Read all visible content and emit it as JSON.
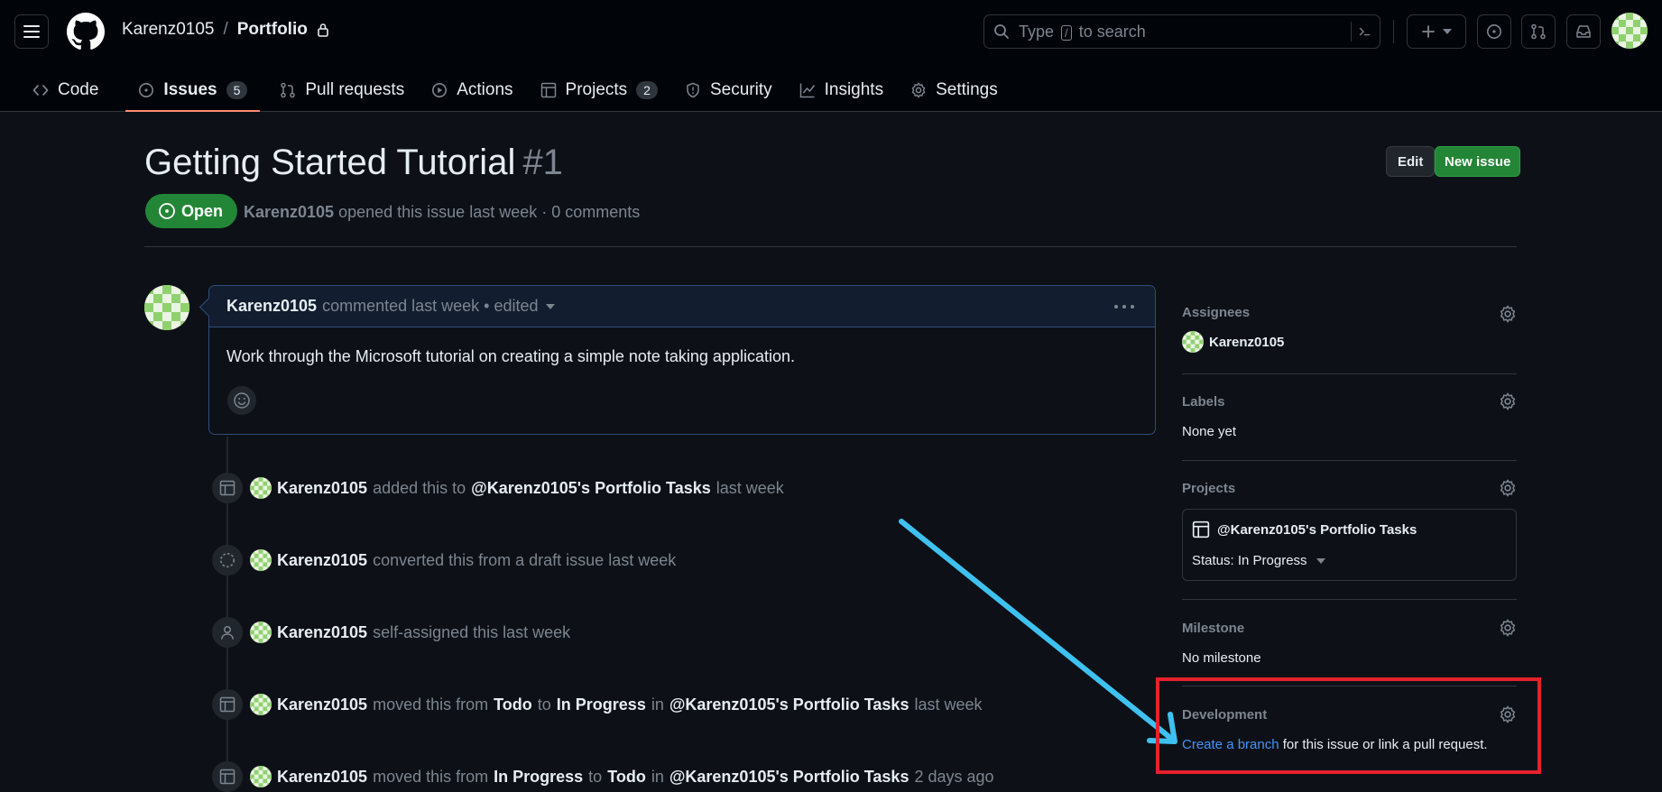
{
  "header": {
    "owner": "Karenz0105",
    "separator": "/",
    "repo": "Portfolio",
    "search_placeholder_pre": "Type",
    "search_key": "/",
    "search_placeholder_post": "to search"
  },
  "repo_nav": {
    "tabs": [
      {
        "label": "Code",
        "icon": "code-icon"
      },
      {
        "label": "Issues",
        "icon": "issue-opened-icon",
        "count": "5",
        "active": true
      },
      {
        "label": "Pull requests",
        "icon": "git-pull-request-icon"
      },
      {
        "label": "Actions",
        "icon": "play-icon"
      },
      {
        "label": "Projects",
        "icon": "table-icon",
        "count": "2"
      },
      {
        "label": "Security",
        "icon": "shield-icon"
      },
      {
        "label": "Insights",
        "icon": "graph-icon"
      },
      {
        "label": "Settings",
        "icon": "gear-icon"
      }
    ]
  },
  "issue": {
    "title": "Getting Started Tutorial",
    "number": "#1",
    "edit_label": "Edit",
    "new_issue_label": "New issue",
    "state": "Open",
    "author": "Karenz0105",
    "meta_text": "opened this issue last week · 0 comments"
  },
  "comment": {
    "author": "Karenz0105",
    "meta": "commented last week • edited",
    "body": "Work through the Microsoft tutorial on creating a simple note taking application."
  },
  "timeline": {
    "events": [
      {
        "actor": "Karenz0105",
        "t1": "added this to",
        "s1": "@Karenz0105's Portfolio Tasks",
        "t2": "last week"
      },
      {
        "actor": "Karenz0105",
        "t1": "converted this from a draft issue last week"
      },
      {
        "actor": "Karenz0105",
        "t1": "self-assigned this last week"
      },
      {
        "actor": "Karenz0105",
        "t1": "moved this from",
        "s1": "Todo",
        "t2": "to",
        "s2": "In Progress",
        "t3": "in",
        "s3": "@Karenz0105's Portfolio Tasks",
        "t4": "last week"
      },
      {
        "actor": "Karenz0105",
        "t1": "moved this from",
        "s1": "In Progress",
        "t2": "to",
        "s2": "Todo",
        "t3": "in",
        "s3": "@Karenz0105's Portfolio Tasks",
        "t4": "2 days ago"
      }
    ]
  },
  "sidebar": {
    "assignees": {
      "title": "Assignees",
      "value": "Karenz0105"
    },
    "labels": {
      "title": "Labels",
      "value": "None yet"
    },
    "projects": {
      "title": "Projects",
      "project_name": "@Karenz0105's Portfolio Tasks",
      "status": "Status: In Progress"
    },
    "milestone": {
      "title": "Milestone",
      "value": "No milestone"
    },
    "development": {
      "title": "Development",
      "link_text": "Create a branch",
      "rest_text": "for this issue or link a pull request."
    }
  },
  "colors": {
    "background": "#0d1117",
    "header_bg": "#010409",
    "open_green": "#238636",
    "link_blue": "#4493f8",
    "active_tab_underline": "#fd8c73",
    "annotation_red": "#e5212d",
    "annotation_arrow": "#3fc1f0"
  }
}
